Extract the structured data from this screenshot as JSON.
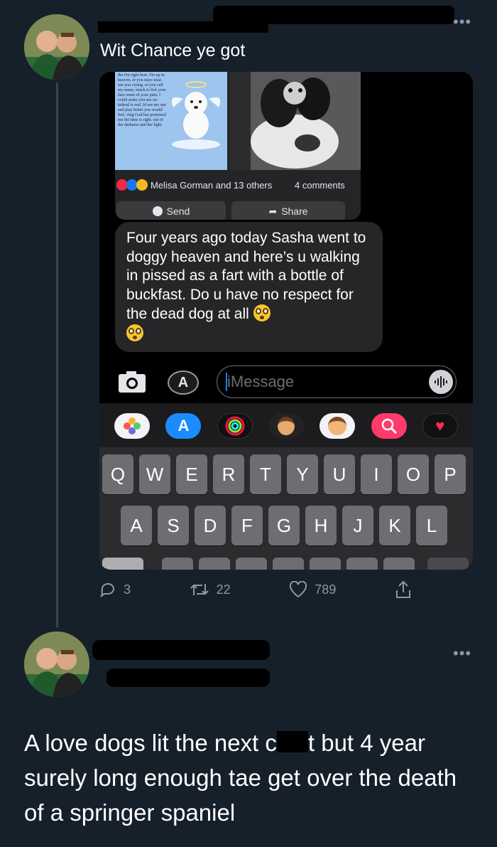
{
  "tweet1": {
    "text": "Wit Chance ye got",
    "more_icon": "ellipsis-icon"
  },
  "screenshot": {
    "poem_text": "the I'm right here. I'm up in heaven, or you stays near. see you crying. es you call my name. much to lick your face some of your pain. I could make you see ou indeed is real. Id see me run and play better you would feel. ving God has promised me the time is right. out of the darkness and the light.",
    "reactions_text": "Melisa Gorman and 13 others",
    "comments_text": "4 comments",
    "send_label": "Send",
    "share_label": "Share",
    "message_text": "Four years ago today Sasha went to doggy heaven and here’s u walking in pissed as a fart with a bottle of buckfast. Do u have no respect for the dead dog at all",
    "imessage_placeholder": "iMessage",
    "keys_row1": [
      "Q",
      "W",
      "E",
      "R",
      "T",
      "Y",
      "U",
      "I",
      "O",
      "P"
    ],
    "keys_row2": [
      "A",
      "S",
      "D",
      "F",
      "G",
      "H",
      "J",
      "K",
      "L"
    ],
    "app_icons": [
      "photos-icon",
      "app-store-icon",
      "activity-icon",
      "memoji-icon",
      "memoji-hearts-icon",
      "web-search-icon",
      "heart-icon"
    ]
  },
  "tweet1_actions": {
    "replies": "3",
    "retweets": "22",
    "likes": "789"
  },
  "tweet2": {
    "text_before": "A love dogs lit the next c",
    "text_after": "t but 4 year surely long enough tae get over the death of a springer spaniel"
  },
  "colors": {
    "background": "#15202b",
    "secondary_text": "#8b98a5",
    "imessage_blue": "#0a84ff"
  }
}
